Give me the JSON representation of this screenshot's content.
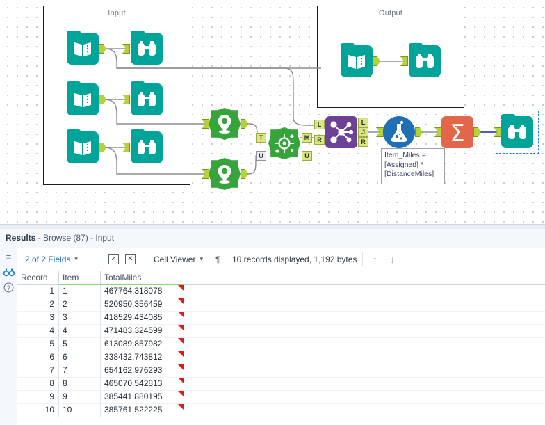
{
  "canvas": {
    "containers": [
      {
        "label": "Input"
      },
      {
        "label": "Output"
      }
    ],
    "tools": [
      {
        "name": "input-data-1",
        "type": "input-data"
      },
      {
        "name": "browse-1",
        "type": "browse"
      },
      {
        "name": "input-data-2",
        "type": "input-data"
      },
      {
        "name": "browse-2",
        "type": "browse"
      },
      {
        "name": "input-data-3",
        "type": "input-data"
      },
      {
        "name": "browse-3",
        "type": "browse"
      },
      {
        "name": "output-input-data",
        "type": "input-data"
      },
      {
        "name": "output-browse",
        "type": "browse"
      },
      {
        "name": "create-points-1",
        "type": "create-points"
      },
      {
        "name": "create-points-2",
        "type": "create-points"
      },
      {
        "name": "find-nearest",
        "type": "find-nearest"
      },
      {
        "name": "join",
        "type": "join"
      },
      {
        "name": "formula",
        "type": "formula"
      },
      {
        "name": "summarize",
        "type": "summarize"
      },
      {
        "name": "browse-final",
        "type": "browse"
      }
    ],
    "anchors": {
      "find_nearest_in_t": "T",
      "find_nearest_in_u": "U",
      "find_nearest_out_m": "M",
      "find_nearest_out_u": "U",
      "join_in_l": "L",
      "join_in_r": "R",
      "join_out_l": "L",
      "join_out_j": "J",
      "join_out_r": "R"
    },
    "annotation": "Item_Miles =\n[Assigned] *\n[DistanceMiles]",
    "colors": {
      "teal": "#00A499",
      "green": "#35A43B",
      "purple": "#6D4196",
      "blue": "#1F6FB4",
      "salmon": "#E2674A",
      "anchor": "#B5D334",
      "selection": "#1b7fd4"
    }
  },
  "results": {
    "title_label": "Results",
    "title_sub": " - Browse (87) - Input",
    "toolbar": {
      "fields_label": "2 of 2 Fields",
      "cell_viewer_label": "Cell Viewer",
      "records_label": "10 records displayed, 1,192 bytes",
      "pilcrow": "¶",
      "up_arrow": "↑",
      "down_arrow": "↓",
      "check_icon": "✓",
      "x_icon": "✕",
      "chevron": "⌄"
    },
    "rail": {
      "list_icon": "≡",
      "browse_icon": "∞",
      "help_icon": "?"
    },
    "table": {
      "columns": [
        "Record",
        "Item",
        "TotalMiles"
      ],
      "rows": [
        {
          "record": "1",
          "item": "1",
          "total": "467764.318078"
        },
        {
          "record": "2",
          "item": "2",
          "total": "520950.356459"
        },
        {
          "record": "3",
          "item": "3",
          "total": "418529.434085"
        },
        {
          "record": "4",
          "item": "4",
          "total": "471483.324599"
        },
        {
          "record": "5",
          "item": "5",
          "total": "613089.857982"
        },
        {
          "record": "6",
          "item": "6",
          "total": "338432.743812"
        },
        {
          "record": "7",
          "item": "7",
          "total": "654162.976293"
        },
        {
          "record": "8",
          "item": "8",
          "total": "465070.542813"
        },
        {
          "record": "9",
          "item": "9",
          "total": "385441.880195"
        },
        {
          "record": "10",
          "item": "10",
          "total": "385761.522225"
        }
      ]
    }
  }
}
